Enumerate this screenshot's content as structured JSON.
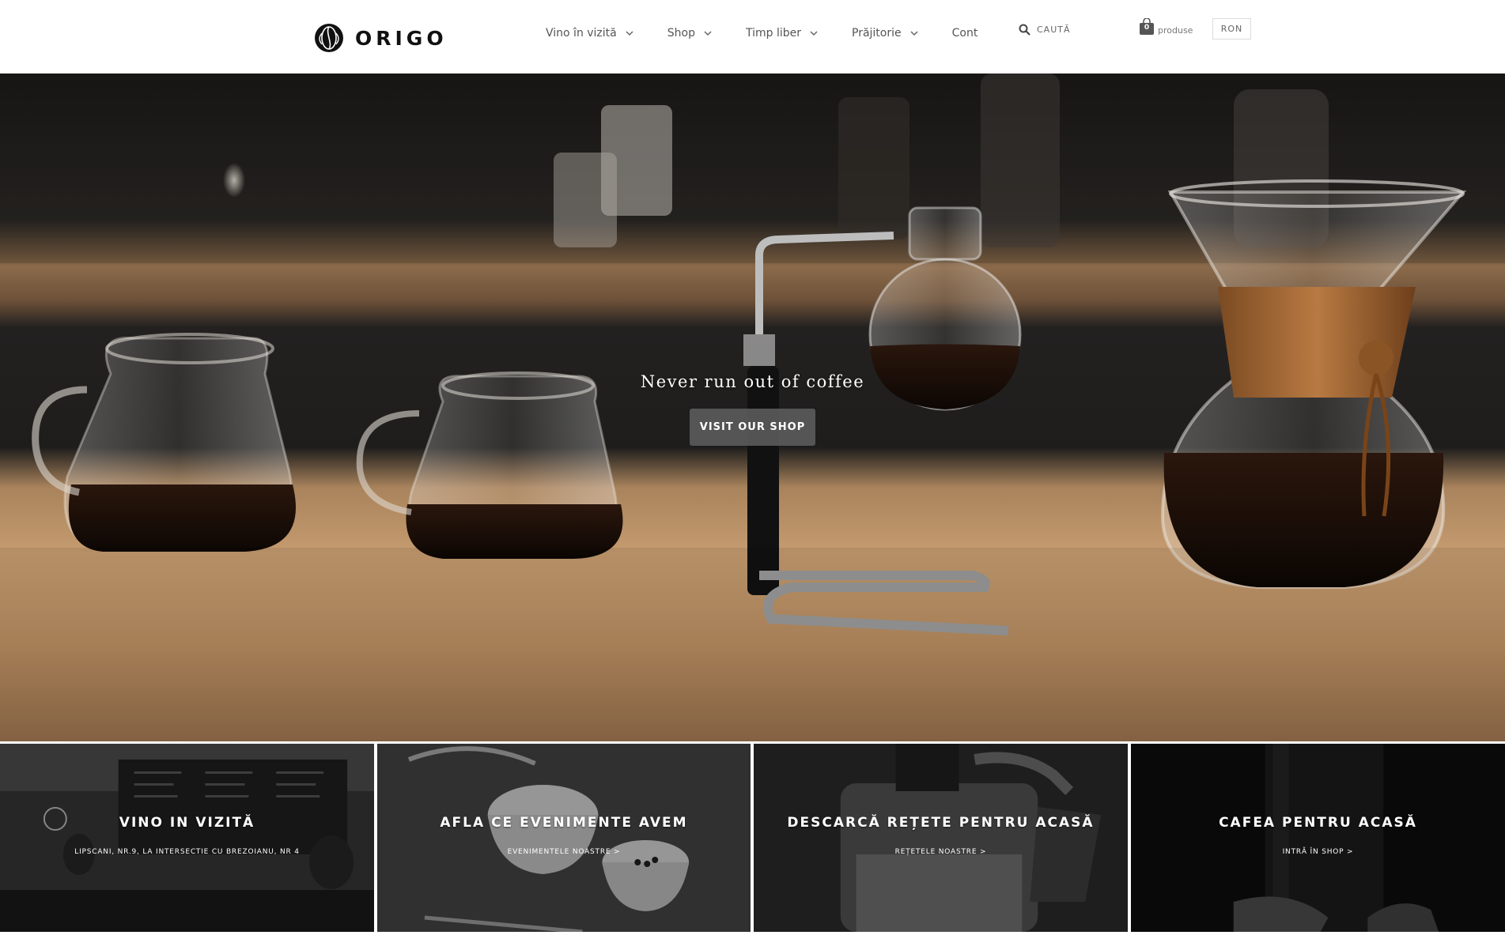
{
  "header": {
    "logo_text": "ORIGO",
    "nav": [
      {
        "label": "Vino în vizită",
        "has_dropdown": true
      },
      {
        "label": "Shop",
        "has_dropdown": true
      },
      {
        "label": "Timp liber",
        "has_dropdown": true
      },
      {
        "label": "Prăjitorie",
        "has_dropdown": true
      },
      {
        "label": "Cont",
        "has_dropdown": false
      }
    ],
    "search_label": "CAUTĂ",
    "cart_count": "0",
    "cart_label": "produse",
    "currency": "RON"
  },
  "hero": {
    "title": "Never run out of coffee",
    "button_label": "VISIT OUR SHOP"
  },
  "tiles": [
    {
      "title": "VINO IN VIZITĂ",
      "subtitle": "LIPSCANI, NR.9, LA INTERSECTIE CU BREZOIANU, NR 4"
    },
    {
      "title": "AFLA CE EVENIMENTE AVEM",
      "subtitle": "EVENIMENTELE NOASTRE >"
    },
    {
      "title": "DESCARCĂ REȚETE PENTRU ACASĂ",
      "subtitle": "REȚETELE NOASTRE >"
    },
    {
      "title": "CAFEA PENTRU ACASĂ",
      "subtitle": "INTRĂ ÎN SHOP >"
    }
  ],
  "colors": {
    "nav_text": "#555555",
    "hero_button": "#5f5f5f",
    "logo": "#111111"
  },
  "icons": {
    "logo": "coffee-bean-icon",
    "dropdown": "chevron-down-icon",
    "search": "search-icon",
    "cart": "shopping-bag-icon"
  }
}
